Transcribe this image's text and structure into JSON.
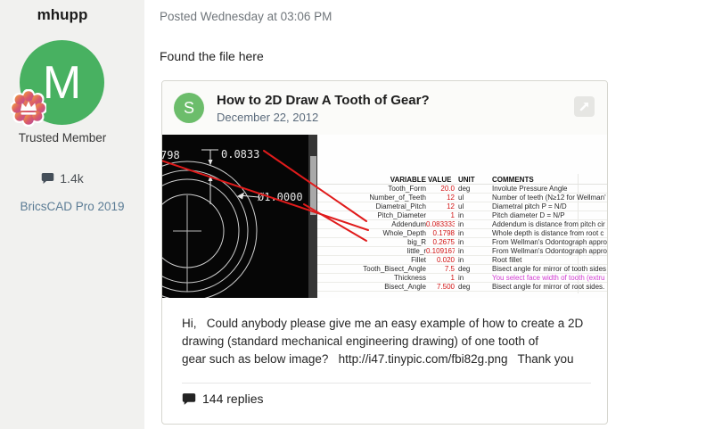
{
  "sidebar": {
    "username": "mhupp",
    "avatar_letter": "M",
    "badge_icon": "crown-seal",
    "rank": "Trusted Member",
    "post_count": "1.4k",
    "product": "BricsCAD Pro 2019"
  },
  "post": {
    "posted_meta": "Posted Wednesday at 03:06 PM",
    "intro": "Found the file here",
    "body": "Hi,   Could anybody please give me an easy example of how to create a 2D\ndrawing (standard mechanical engineering drawing) of one tooth of\ngear such as below image?   http://i47.tinypic.com/fbi82g.png   Thank you",
    "replies_label": "144 replies"
  },
  "embed": {
    "avatar_letter": "S",
    "title": "How to 2D Draw A Tooth of Gear?",
    "date": "December 22, 2012",
    "image": {
      "dim_partial": "798",
      "dim_addendum": "0.0833",
      "dim_diameter": "Ø1.0000",
      "table": {
        "headers": [
          "VARIABLE",
          "VALUE",
          "UNIT",
          "COMMENTS"
        ],
        "rows": [
          [
            "Tooth_Form",
            "20.0",
            "deg",
            "Involute Pressure Angle",
            ""
          ],
          [
            "Number_of_Teeth",
            "12",
            "ul",
            "Number of teeth (N≥12 for Wellman'",
            ""
          ],
          [
            "Diametral_Pitch",
            "12",
            "ul",
            "Diametral pitch P = N/D",
            ""
          ],
          [
            "Pitch_Diameter",
            "1",
            "in",
            "Pitch diameter D = N/P",
            ""
          ],
          [
            "Addendum",
            "0.083333",
            "in",
            "Addendum is distance from pitch cir",
            ""
          ],
          [
            "Whole_Depth",
            "0.1798",
            "in",
            "Whole depth is distance from root c",
            ""
          ],
          [
            "big_R",
            "0.2675",
            "in",
            "From Wellman's Odontograph appro",
            ""
          ],
          [
            "little_r",
            "0.109167",
            "in",
            "From Wellman's Odontograph appro",
            ""
          ],
          [
            "Fillet",
            "0.020",
            "in",
            "Root fillet",
            ""
          ],
          [
            "Tooth_Bisect_Angle",
            "7.5",
            "deg",
            "Bisect angle for mirror of tooth sides",
            ""
          ],
          [
            "Thickness",
            "1",
            "in",
            "You select face width of tooth (extru",
            "magenta"
          ],
          [
            "Bisect_Angle",
            "7.500",
            "deg",
            "Bisect angle for mirror of root sides.",
            ""
          ]
        ]
      }
    }
  },
  "colors": {
    "accent_green": "#48b161",
    "embed_green": "#6cbd6b",
    "value_red": "#d21414",
    "annotation_red": "#e01b1b",
    "magenta": "#d23bd2",
    "sidebar_bg": "#f1f1ef",
    "link_blue_gray": "#5b7c95"
  }
}
